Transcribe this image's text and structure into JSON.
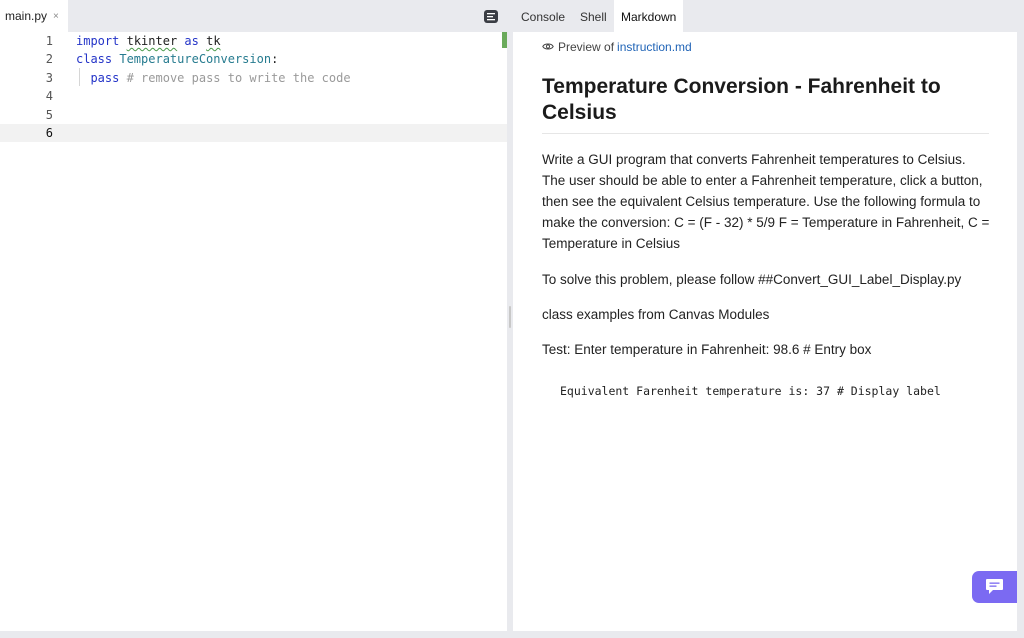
{
  "editor": {
    "file_tab": {
      "label": "main.py",
      "close": "×"
    },
    "lines": [
      {
        "number": "1",
        "tokens": [
          {
            "text": "import",
            "cls": "kw"
          },
          {
            "text": " "
          },
          {
            "text": "tkinter",
            "cls": "squig"
          },
          {
            "text": " "
          },
          {
            "text": "as",
            "cls": "kw"
          },
          {
            "text": " "
          },
          {
            "text": "tk",
            "cls": "squig"
          }
        ]
      },
      {
        "number": "2",
        "tokens": [
          {
            "text": "class",
            "cls": "kw"
          },
          {
            "text": " "
          },
          {
            "text": "TemperatureConversion",
            "cls": "cls"
          },
          {
            "text": ":"
          }
        ]
      },
      {
        "number": "3",
        "tokens": [
          {
            "text": "  "
          },
          {
            "text": "pass",
            "cls": "kw"
          },
          {
            "text": " "
          },
          {
            "text": "# remove pass to write the code",
            "cls": "cm"
          }
        ]
      },
      {
        "number": "4",
        "tokens": []
      },
      {
        "number": "5",
        "tokens": []
      },
      {
        "number": "6",
        "tokens": []
      }
    ],
    "active_line": "6"
  },
  "right_tabs": [
    {
      "label": "Console",
      "active": false
    },
    {
      "label": "Shell",
      "active": false
    },
    {
      "label": "Markdown",
      "active": true
    }
  ],
  "preview": {
    "header_prefix": "Preview of",
    "file_link": "instruction.md",
    "title": "Temperature Conversion - Fahrenheit to Celsius",
    "paragraphs": [
      "Write a GUI program that converts Fahrenheit temperatures to Celsius. The user should be able to enter a Fahrenheit temperature, click a button, then see the equivalent Celsius temperature. Use the following formula to make the conversion: C = (F - 32) * 5/9 F = Temperature in Fahrenheit, C = Temperature in Celsius",
      "To solve this problem, please follow ##Convert_GUI_Label_Display.py",
      "class examples from Canvas Modules",
      "Test: Enter temperature in Fahrenheit: 98.6 # Entry box"
    ],
    "code_block": "Equivalent Farenheit temperature is: 37 # Display label"
  },
  "icons": {
    "editor_menu": "menu-icon",
    "eye": "eye-icon",
    "chat": "chat-icon"
  },
  "colors": {
    "keyword": "#2434c8",
    "class_name": "#267b8f",
    "comment": "#9a9a9a",
    "link": "#1f63b6",
    "chat_button": "#7b6af2",
    "change_marker": "#6aaa5b"
  }
}
